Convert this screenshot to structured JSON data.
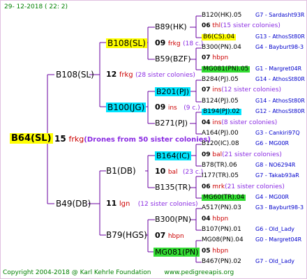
{
  "header": "29-  12-2018  (  22:  2)",
  "colors": {
    "yellow": "#ffff00",
    "cyan": "#00e5ff",
    "green": "#33dd33",
    "red": "#cc0000",
    "blue": "#0000cc",
    "purple": "#8a2be2",
    "olive": "#808000",
    "lines": "#6a00a0"
  },
  "nodes": [
    {
      "id": "b64",
      "label": "B64(SL)",
      "hl": "yellow",
      "bold": true
    },
    {
      "id": "b108",
      "label": "B108(SL)"
    },
    {
      "id": "b49",
      "label": "B49(DB)"
    },
    {
      "id": "b108b",
      "label": "B108(SL)",
      "hl": "yellow"
    },
    {
      "id": "b100",
      "label": "B100(JG)",
      "hl": "cyan"
    },
    {
      "id": "b1",
      "label": "B1(DB)"
    },
    {
      "id": "b79",
      "label": "B79(HGS)"
    },
    {
      "id": "b89",
      "label": "B89(HK)"
    },
    {
      "id": "b59",
      "label": "B59(BZF)"
    },
    {
      "id": "b201",
      "label": "B201(PJ)",
      "hl": "cyan"
    },
    {
      "id": "b271",
      "label": "B271(PJ)"
    },
    {
      "id": "b164",
      "label": "B164(IC)",
      "hl": "cyan"
    },
    {
      "id": "b135",
      "label": "B135(TR)"
    },
    {
      "id": "b300",
      "label": "B300(PN)"
    },
    {
      "id": "mg081",
      "label": "MG081(PN)",
      "hl": "green"
    }
  ],
  "gen_notes": [
    {
      "id": "g15",
      "year": "15",
      "code": "frkg",
      "note": "(Drones from 50 sister colonies)"
    },
    {
      "id": "g12",
      "year": "12",
      "code": "frkg",
      "note": "(28 sister colonies)"
    },
    {
      "id": "g11",
      "year": "11",
      "code": "lgn",
      "note": "(12 sister colonies)"
    },
    {
      "id": "g09a",
      "year": "09",
      "code": "frkg",
      "note": "(18 c.)"
    },
    {
      "id": "g09b",
      "year": "09",
      "code": "ins",
      "note": "(9 c.)"
    },
    {
      "id": "g10",
      "year": "10",
      "code": "bal",
      "note": "(23 c.)"
    },
    {
      "id": "g07",
      "year": "07",
      "code": "hbpn",
      "note": ""
    }
  ],
  "leaves": [
    {
      "a": "B120(HK).05",
      "b": "G7 - Sardasht93R"
    },
    {
      "a": "06 thl(15 sister colonies)"
    },
    {
      "a": "B6(CS).04",
      "hl": "yellow",
      "b": "G13 - AthosSt80R"
    },
    {
      "a": "B300(PN).04",
      "b": "G4 - Bayburt98-3"
    },
    {
      "a": "07 hbpn"
    },
    {
      "a": "MG081(PN).05",
      "hl": "green",
      "b": "G1 - Margret04R"
    },
    {
      "a": "B284(PJ).05",
      "b": "G14 - AthosSt80R"
    },
    {
      "a": "07 ins(12 sister colonies)"
    },
    {
      "a": "B124(PJ).05",
      "b": "G14 - AthosSt80R"
    },
    {
      "a": "B194(PJ).02",
      "hl": "cyan",
      "b": "G12 - AthosSt80R"
    },
    {
      "a": "04 ins(8 sister colonies)"
    },
    {
      "a": "A164(PJ).00",
      "b": "G3 - Cankiri97Q"
    },
    {
      "a": "B120(IC).08",
      "b": "G6 - MG00R"
    },
    {
      "a": "09 bal(21 sister colonies)"
    },
    {
      "a": "B78(TR).06",
      "b": "G8 - NO6294R"
    },
    {
      "a": "I177(TR).05",
      "b": "G7 - Takab93aR"
    },
    {
      "a": "06 mrk(21 sister colonies)"
    },
    {
      "a": "MG60(TR).04",
      "hl": "green",
      "b": "G4 - MG00R"
    },
    {
      "a": "A517(PN).03",
      "b": "G3 - Bayburt98-3"
    },
    {
      "a": "04 hbpn"
    },
    {
      "a": "B107(PN).01",
      "b": "G6 - Old_Lady"
    },
    {
      "a": "MG08(PN).04",
      "b": "G0 - Margret04R"
    },
    {
      "a": "05 hbpn"
    },
    {
      "a": "B467(PN).02",
      "b": "G7 - Old_Lady"
    }
  ],
  "footer": {
    "copyright": "Copyright 2004-2018 @ Karl Kehrle Foundation",
    "url": "www.pedigreeapis.org"
  }
}
